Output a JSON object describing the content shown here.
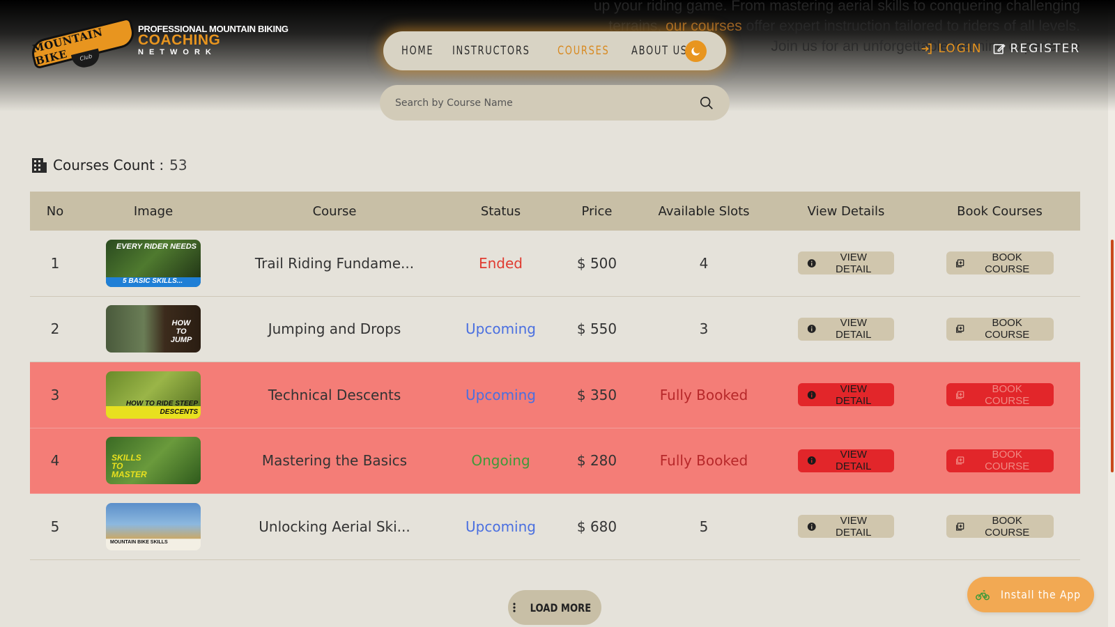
{
  "hero": {
    "line1": "up your riding game. From mastering aerial skills to conquering challenging",
    "line2_pre": "terrains, ",
    "line2_hl": "our courses",
    "line2_post": " offer expert instruction tailored to riders of all levels.",
    "line3": "Join us for an unforgettable learning experience"
  },
  "logo": {
    "badge": "MOUNTAIN BIKE",
    "club": "Club",
    "line1": "PROFESSIONAL MOUNTAIN BIKING",
    "line2": "COACHING",
    "line3": "NETWORK"
  },
  "nav": {
    "items": [
      {
        "label": "HOME"
      },
      {
        "label": "INSTRUCTORS"
      },
      {
        "label": "COURSES"
      },
      {
        "label": "ABOUT US"
      }
    ],
    "active": "COURSES",
    "theme_icon": "moon-icon"
  },
  "auth": {
    "login": "LOGIN",
    "register": "REGISTER"
  },
  "search": {
    "placeholder": "Search by Course Name",
    "value": ""
  },
  "count": {
    "label": "Courses Count :",
    "value": "53"
  },
  "table": {
    "headers": [
      "No",
      "Image",
      "Course",
      "Status",
      "Price",
      "Available Slots",
      "View Details",
      "Book Courses"
    ],
    "rows": [
      {
        "no": "1",
        "thumb_text": "EVERY RIDER NEEDS",
        "thumb_bar": "5 BASIC SKILLS...",
        "course": "Trail Riding Fundame...",
        "status": "Ended",
        "price": "$ 500",
        "slots": "4",
        "view": "VIEW DETAIL",
        "book": "BOOK COURSE"
      },
      {
        "no": "2",
        "thumb_text": "HOW TO JUMP",
        "thumb_bar": "",
        "course": "Jumping and Drops",
        "status": "Upcoming",
        "price": "$ 550",
        "slots": "3",
        "view": "VIEW DETAIL",
        "book": "BOOK COURSE"
      },
      {
        "no": "3",
        "thumb_text": "",
        "thumb_bar": "HOW TO RIDE STEEP DESCENTS",
        "course": "Technical Descents",
        "status": "Upcoming",
        "price": "$ 350",
        "slots": "Fully Booked",
        "view": "VIEW DETAIL",
        "book": "BOOK COURSE"
      },
      {
        "no": "4",
        "thumb_text": "SKILLS TO MASTER",
        "thumb_bar": "",
        "course": "Mastering the Basics",
        "status": "Ongoing",
        "price": "$ 280",
        "slots": "Fully Booked",
        "view": "VIEW DETAIL",
        "book": "BOOK COURSE"
      },
      {
        "no": "5",
        "thumb_text": "",
        "thumb_bar": "MOUNTAIN BIKE SKILLS",
        "course": "Unlocking Aerial Ski...",
        "status": "Upcoming",
        "price": "$ 680",
        "slots": "5",
        "view": "VIEW DETAIL",
        "book": "BOOK COURSE"
      }
    ]
  },
  "load_more": "LOAD MORE",
  "install": "Install the App",
  "colors": {
    "accent": "#e8951f",
    "background": "#e5e2da",
    "header_row": "#c8bfa6",
    "booked_row": "#f47d77",
    "ended": "#e03b30",
    "upcoming": "#4a6fe0",
    "ongoing": "#3e9a3a"
  }
}
